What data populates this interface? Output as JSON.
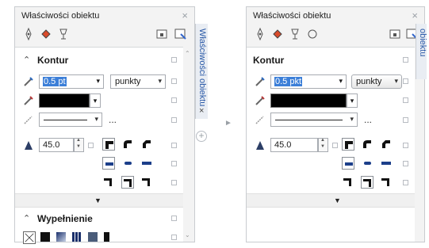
{
  "left": {
    "title": "Właściwości obiektu",
    "close": "×",
    "tab_close": "×",
    "vertical_tab": "Właściwości obiektu",
    "outline_section": "Kontur",
    "fill_section": "Wypełnienie",
    "outline": {
      "width_value": "0.5 pt",
      "units_value": "punkty",
      "miter_value": "45.0",
      "more": "..."
    }
  },
  "right": {
    "title": "Właściwości obiektu",
    "close": "×",
    "vertical_tab": "Właściwości obiektu",
    "outline_section": "Kontur",
    "outline": {
      "width_value": "0.5 pkt",
      "units_value": "punkty",
      "miter_value": "45.0",
      "more": "..."
    }
  },
  "glyphs": {
    "collapse": "⌃",
    "expand_down": "▼",
    "dropdown": "▾",
    "add": "+",
    "transition": "►"
  }
}
